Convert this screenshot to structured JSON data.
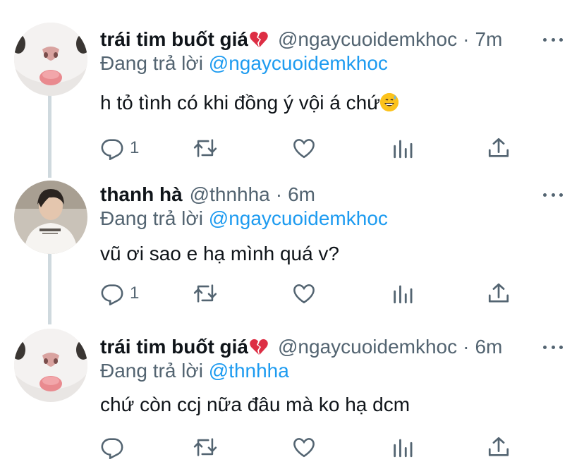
{
  "tweets": [
    {
      "name": "trái tim buốt giá",
      "name_emoji": "💔",
      "handle": "@ngaycuoidemkhoc",
      "separator": "·",
      "time": "7m",
      "reply_prefix": "Đang trả lời",
      "reply_mention": "@ngaycuoidemkhoc",
      "text": "h tỏ tình có khi đồng ý vội á chứ",
      "text_emoji": "😅",
      "reply_count": "1",
      "avatar": "cat-avatar-icon"
    },
    {
      "name": "thanh hà",
      "handle": "@thnhha",
      "separator": "·",
      "time": "6m",
      "reply_prefix": "Đang trả lời",
      "reply_mention": "@ngaycuoidemkhoc",
      "text": "vũ ơi sao e hạ mình quá v?",
      "reply_count": "1",
      "avatar": "person-avatar-icon"
    },
    {
      "name": "trái tim buốt giá",
      "name_emoji": "💔",
      "handle": "@ngaycuoidemkhoc",
      "separator": "·",
      "time": "6m",
      "reply_prefix": "Đang trả lời",
      "reply_mention": "@thnhha",
      "text": "chứ còn ccj nữa đâu mà ko hạ dcm",
      "reply_count": "",
      "avatar": "cat-avatar-icon"
    }
  ],
  "icons": {
    "reply": "reply-icon",
    "retweet": "retweet-icon",
    "like": "heart-icon",
    "analytics": "analytics-icon",
    "share": "share-icon",
    "more": "more-icon"
  },
  "colors": {
    "text": "#0f1419",
    "secondary": "#536471",
    "link": "#1d9bf0",
    "thread_line": "#cfd9de"
  }
}
